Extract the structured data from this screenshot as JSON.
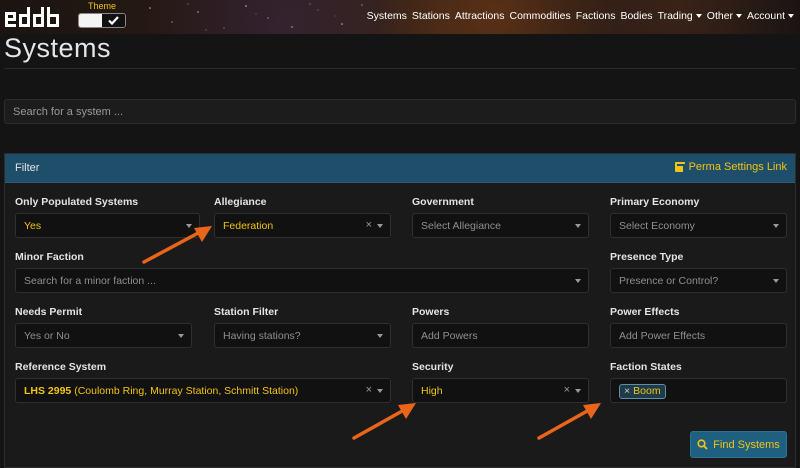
{
  "brand": {
    "logo_text": "eddb",
    "icon": "eddb-logo-icon"
  },
  "theme": {
    "label": "Theme",
    "options": [
      "light",
      "dark"
    ],
    "selected": "dark"
  },
  "nav": {
    "items": [
      {
        "label": "Systems",
        "dropdown": false
      },
      {
        "label": "Stations",
        "dropdown": false
      },
      {
        "label": "Attractions",
        "dropdown": false
      },
      {
        "label": "Commodities",
        "dropdown": false
      },
      {
        "label": "Factions",
        "dropdown": false
      },
      {
        "label": "Bodies",
        "dropdown": false
      },
      {
        "label": "Trading",
        "dropdown": true
      },
      {
        "label": "Other",
        "dropdown": true
      },
      {
        "label": "Account",
        "dropdown": true
      }
    ]
  },
  "page": {
    "title": "Systems"
  },
  "search": {
    "placeholder": "Search for a system ..."
  },
  "filter": {
    "title": "Filter",
    "perma_link": "Perma Settings Link",
    "perma_icon": "external-link-icon",
    "fields": {
      "only_populated": {
        "label": "Only Populated Systems",
        "value": "Yes"
      },
      "allegiance": {
        "label": "Allegiance",
        "value": "Federation"
      },
      "government": {
        "label": "Government",
        "placeholder": "Select Allegiance"
      },
      "primary_economy": {
        "label": "Primary Economy",
        "placeholder": "Select Economy"
      },
      "minor_faction": {
        "label": "Minor Faction",
        "placeholder": "Search for a minor faction ..."
      },
      "presence_type": {
        "label": "Presence Type",
        "placeholder": "Presence or Control?"
      },
      "needs_permit": {
        "label": "Needs Permit",
        "placeholder": "Yes or No"
      },
      "station_filter": {
        "label": "Station Filter",
        "placeholder": "Having stations?"
      },
      "powers": {
        "label": "Powers",
        "placeholder": "Add Powers"
      },
      "power_effects": {
        "label": "Power Effects",
        "placeholder": "Add Power Effects"
      },
      "reference_system": {
        "label": "Reference System",
        "value_name": "LHS 2995",
        "value_detail": "(Coulomb Ring, Murray Station, Schmitt Station)"
      },
      "security": {
        "label": "Security",
        "value": "High"
      },
      "faction_states": {
        "label": "Faction States",
        "tags": [
          "Boom"
        ]
      }
    },
    "find_button": "Find Systems",
    "find_icon": "search-icon"
  },
  "annotations": {
    "arrow_color": "#e8651a",
    "arrows": [
      "allegiance-arrow",
      "security-arrow",
      "faction-states-arrow"
    ]
  },
  "colors": {
    "accent": "#f0c414",
    "panel_header": "#1e4e6a",
    "button": "#1f5f80",
    "background": "#141414"
  }
}
